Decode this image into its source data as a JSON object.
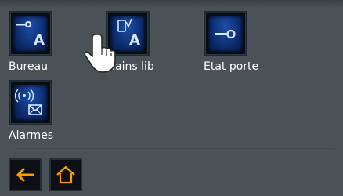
{
  "tiles": [
    {
      "label": "Bureau",
      "icon": "key-a-icon"
    },
    {
      "label": "Mains lib",
      "icon": "handsfree-a-icon"
    },
    {
      "label": "Etat porte",
      "icon": "key-icon"
    },
    {
      "label": "Alarmes",
      "icon": "alarm-mail-icon"
    }
  ],
  "nav": {
    "back_icon": "arrow-left-icon",
    "home_icon": "home-icon"
  },
  "colors": {
    "background": "#4a5157",
    "tile_blue": "#1b4fa8",
    "accent_orange": "#ff9a00",
    "glyph": "#d8e8ff"
  }
}
